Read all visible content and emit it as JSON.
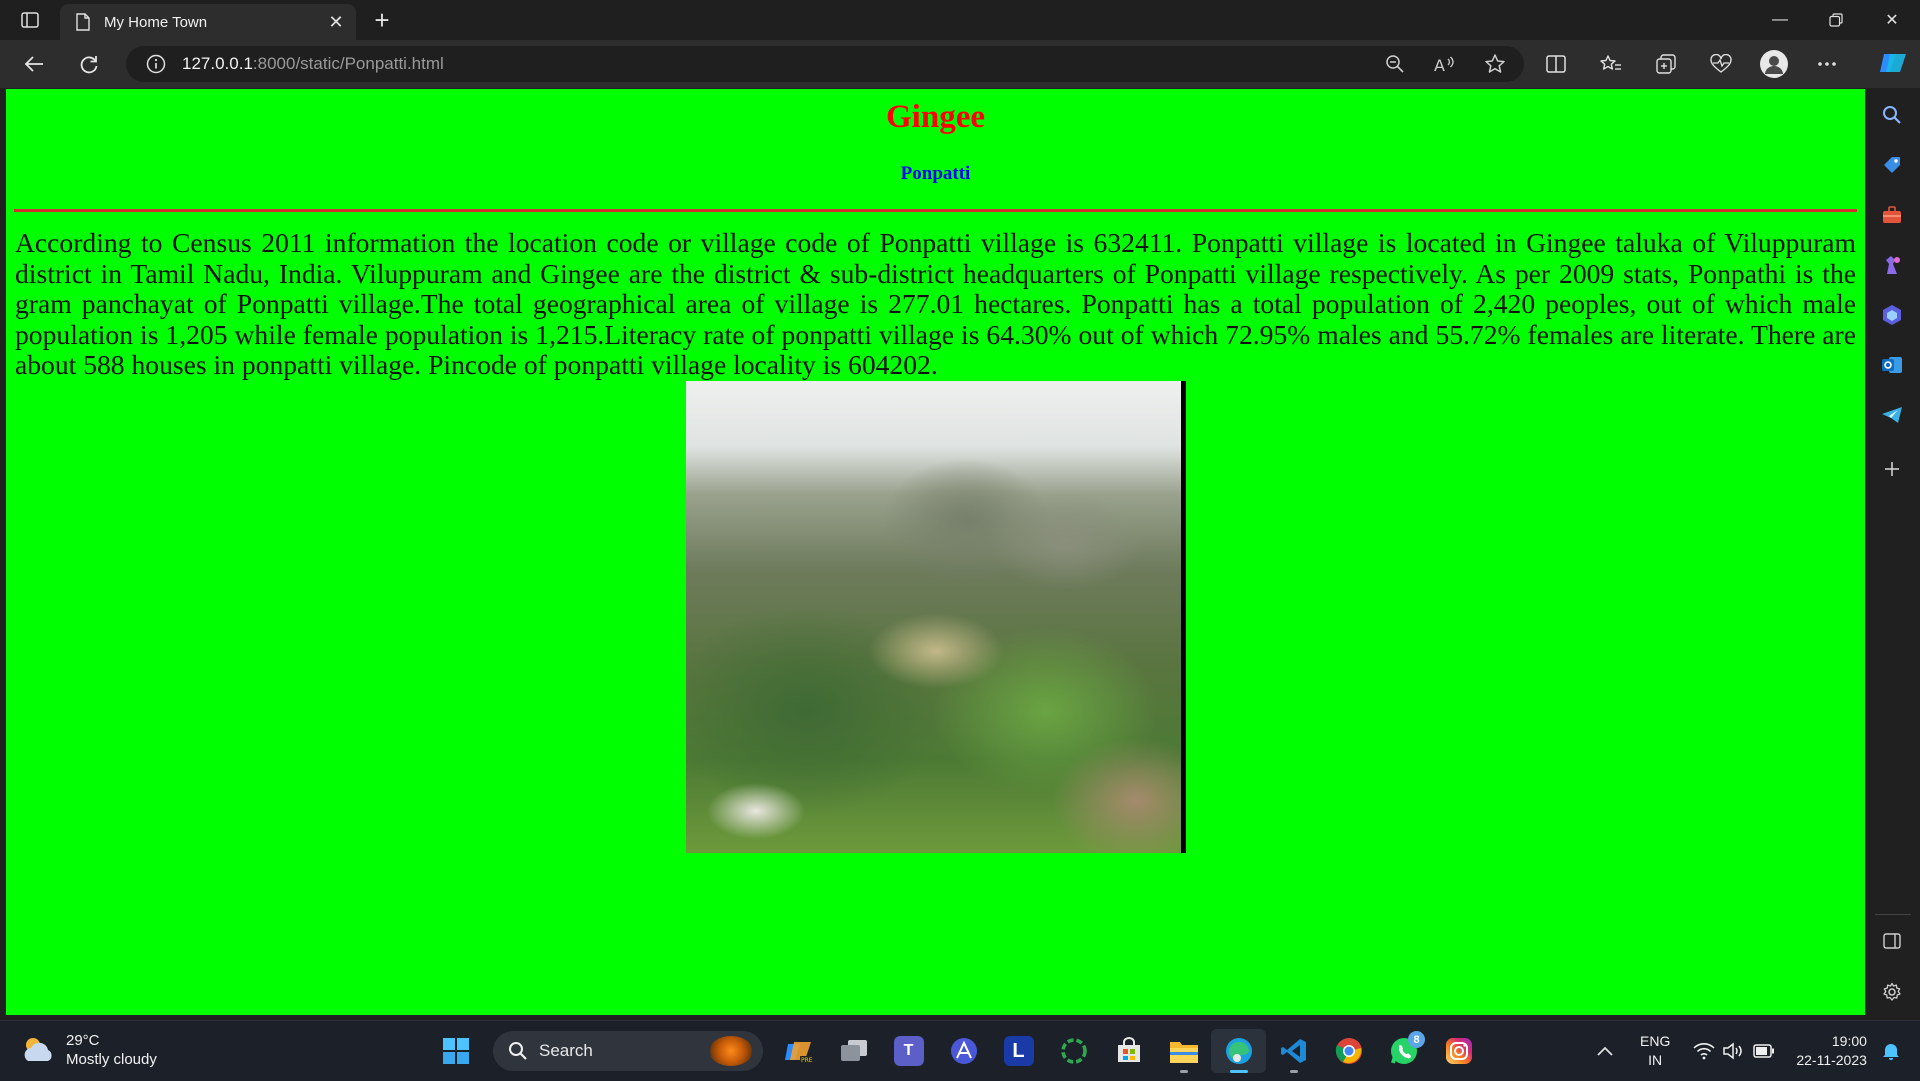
{
  "browser": {
    "tab_title": "My Home Town",
    "url_host": "127.0.0.1",
    "url_path": ":8000/static/Ponpatti.html"
  },
  "page": {
    "heading": "Gingee",
    "subheading": "Ponpatti",
    "paragraph": "According to Census 2011 information the location code or village code of Ponpatti village is 632411. Ponpatti village is located in Gingee taluka of Viluppuram district in Tamil Nadu, India. Viluppuram and Gingee are the district & sub-district headquarters of Ponpatti village respectively. As per 2009 stats, Ponpathi is the gram panchayat of Ponpatti village.The total geographical area of village is 277.01 hectares. Ponpatti has a total population of 2,420 peoples, out of which male population is 1,205 while female population is 1,215.Literacy rate of ponpatti village is 64.30% out of which 72.95% males and 55.72% females are literate. There are about 588 houses in ponpatti village. Pincode of ponpatti village locality is 604202.",
    "colors": {
      "background": "#00ff00",
      "heading": "#ff0000",
      "subheading": "#0000ff",
      "rule": "#d03030"
    }
  },
  "taskbar": {
    "weather_temp": "29°C",
    "weather_desc": "Mostly cloudy",
    "search_label": "Search",
    "whatsapp_badge": "8",
    "lang_line1": "ENG",
    "lang_line2": "IN",
    "time": "19:00",
    "date": "22-11-2023"
  },
  "icons": {
    "toolbar": [
      "back-icon",
      "refresh-icon",
      "info-icon",
      "zoom-out-icon",
      "read-aloud-icon",
      "favorite-star-icon",
      "split-screen-icon",
      "favorites-icon",
      "collections-icon",
      "browser-essentials-icon",
      "profile-icon",
      "more-icon",
      "copilot-icon"
    ],
    "sidebar": [
      "search-icon",
      "shopping-icon",
      "tools-icon",
      "games-icon",
      "microsoft-365-icon",
      "outlook-icon",
      "telegram-icon",
      "add-icon",
      "sidebar-toggle-icon",
      "settings-icon"
    ]
  }
}
